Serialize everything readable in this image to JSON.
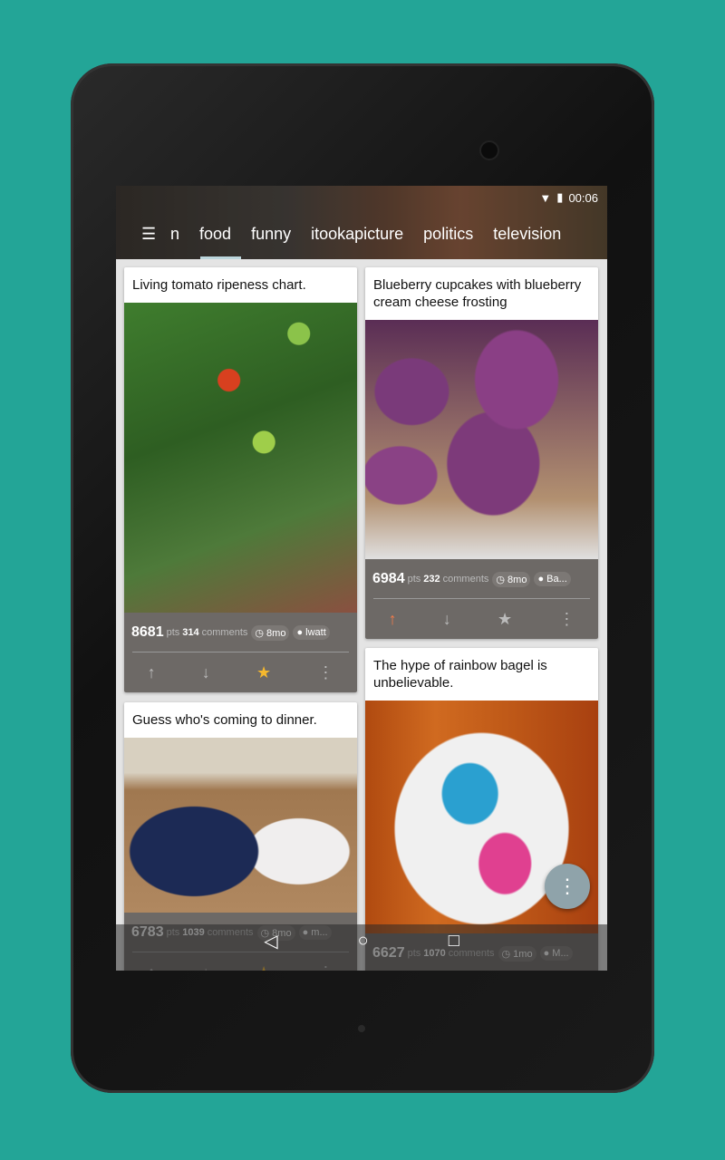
{
  "status": {
    "time": "00:06",
    "wifi_icon": "wifi-icon",
    "battery_icon": "battery-charging-icon"
  },
  "tabs": [
    {
      "label": "n"
    },
    {
      "label": "food"
    },
    {
      "label": "funny"
    },
    {
      "label": "itookapicture"
    },
    {
      "label": "politics"
    },
    {
      "label": "television"
    }
  ],
  "active_tab": "food",
  "posts": [
    {
      "title": "Living tomato ripeness chart.",
      "points": "8681",
      "pts_label": "pts",
      "comments": "314",
      "comments_label": "comments",
      "age": "8mo",
      "author": "lwatt",
      "upvoted": false,
      "starred": true
    },
    {
      "title": "Blueberry cupcakes with blueberry cream cheese frosting",
      "points": "6984",
      "pts_label": "pts",
      "comments": "232",
      "comments_label": "comments",
      "age": "8mo",
      "author": "Ba...",
      "upvoted": true,
      "starred": false
    },
    {
      "title": "Guess who's coming to dinner.",
      "points": "6783",
      "pts_label": "pts",
      "comments": "1039",
      "comments_label": "comments",
      "age": "8mo",
      "author": "m...",
      "upvoted": false,
      "starred": true
    },
    {
      "title": "The hype of rainbow bagel is unbelievable.",
      "points": "6627",
      "pts_label": "pts",
      "comments": "1070",
      "comments_label": "comments",
      "age": "1mo",
      "author": "M...",
      "upvoted": false,
      "starred": false
    }
  ],
  "colors": {
    "background": "#23a597",
    "upvote": "#f07b4a",
    "star": "#f5b82e"
  }
}
